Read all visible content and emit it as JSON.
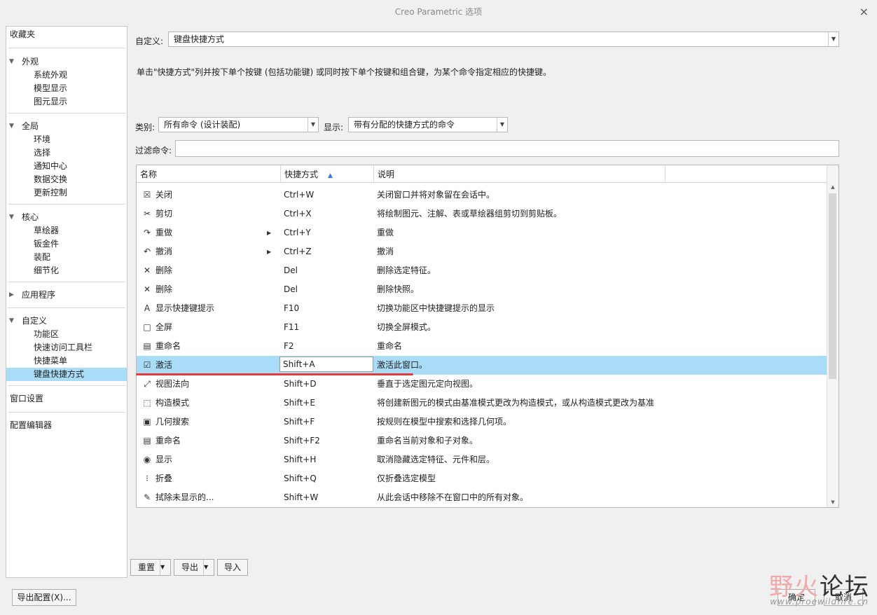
{
  "window": {
    "title": "Creo Parametric 选项",
    "close_glyph": "×"
  },
  "sidebar": {
    "favorites": "收藏夹",
    "groups": [
      {
        "title": "外观",
        "expanded": true,
        "items": [
          "系统外观",
          "模型显示",
          "图元显示"
        ]
      },
      {
        "title": "全局",
        "expanded": true,
        "items": [
          "环境",
          "选择",
          "通知中心",
          "数据交换",
          "更新控制"
        ]
      },
      {
        "title": "核心",
        "expanded": true,
        "items": [
          "草绘器",
          "钣金件",
          "装配",
          "细节化"
        ]
      },
      {
        "title": "应用程序",
        "expanded": false,
        "items": []
      },
      {
        "title": "自定义",
        "expanded": true,
        "items": [
          "功能区",
          "快速访问工具栏",
          "快捷菜单",
          "键盘快捷方式"
        ]
      }
    ],
    "selected_item": "键盘快捷方式",
    "window_settings": "窗口设置",
    "config_editor": "配置编辑器"
  },
  "customize": {
    "label": "自定义:",
    "value": "键盘快捷方式"
  },
  "instruction": "单击\"快捷方式\"列并按下单个按键 (包括功能键) 或同时按下单个按键和组合键，为某个命令指定相应的快捷键。",
  "category": {
    "label": "类别:",
    "value": "所有命令 (设计装配)"
  },
  "display": {
    "label": "显示:",
    "value": "带有分配的快捷方式的命令"
  },
  "filter": {
    "label": "过滤命令:",
    "value": ""
  },
  "table": {
    "columns": [
      "名称",
      "快捷方式",
      "说明"
    ],
    "sort_glyph": "▲",
    "rows": [
      {
        "icon": "close-window-icon",
        "glyph": "☒",
        "name": "关闭",
        "shortcut": "Ctrl+W",
        "desc": "关闭窗口并将对象留在会话中。"
      },
      {
        "icon": "scissors-icon",
        "glyph": "✂",
        "name": "剪切",
        "shortcut": "Ctrl+X",
        "desc": "将绘制图元、注解、表或草绘器组剪切到剪贴板。"
      },
      {
        "icon": "redo-icon",
        "glyph": "↷",
        "name": "重做",
        "shortcut": "Ctrl+Y",
        "desc": "重做",
        "submenu": true
      },
      {
        "icon": "undo-icon",
        "glyph": "↶",
        "name": "撤消",
        "shortcut": "Ctrl+Z",
        "desc": "撤消",
        "submenu": true
      },
      {
        "icon": "delete-icon",
        "glyph": "✕",
        "name": "删除",
        "shortcut": "Del",
        "desc": "删除选定特征。"
      },
      {
        "icon": "delete-icon",
        "glyph": "✕",
        "name": "删除",
        "shortcut": "Del",
        "desc": "删除快照。"
      },
      {
        "icon": "keytip-icon",
        "glyph": "A",
        "name": "显示快捷键提示",
        "shortcut": "F10",
        "desc": "切换功能区中快捷键提示的显示"
      },
      {
        "icon": "fullscreen-icon",
        "glyph": "□",
        "name": "全屏",
        "shortcut": "F11",
        "desc": "切换全屏模式。"
      },
      {
        "icon": "rename-icon",
        "glyph": "▤",
        "name": "重命名",
        "shortcut": "F2",
        "desc": "重命名"
      },
      {
        "icon": "activate-icon",
        "glyph": "☑",
        "name": "激活",
        "shortcut": "Shift+A",
        "desc": "激活此窗口。",
        "selected": true
      },
      {
        "icon": "view-normal-icon",
        "glyph": "⤢",
        "name": "视图法向",
        "shortcut": "Shift+D",
        "desc": "垂直于选定图元定向视图。"
      },
      {
        "icon": "construction-mode-icon",
        "glyph": "⬚",
        "name": "构造模式",
        "shortcut": "Shift+E",
        "desc": "将创建新图元的模式由基准模式更改为构造模式，或从构造模式更改为基准"
      },
      {
        "icon": "geometry-search-icon",
        "glyph": "▣",
        "name": "几何搜索",
        "shortcut": "Shift+F",
        "desc": "按规则在模型中搜索和选择几何项。"
      },
      {
        "icon": "rename-icon",
        "glyph": "▤",
        "name": "重命名",
        "shortcut": "Shift+F2",
        "desc": "重命名当前对象和子对象。"
      },
      {
        "icon": "eye-icon",
        "glyph": "◉",
        "name": "显示",
        "shortcut": "Shift+H",
        "desc": "取消隐藏选定特征、元件和层。"
      },
      {
        "icon": "collapse-icon",
        "glyph": "⁝",
        "name": "折叠",
        "shortcut": "Shift+Q",
        "desc": "仅折叠选定模型"
      },
      {
        "icon": "erase-icon",
        "glyph": "✎",
        "name": "拭除未显示的...",
        "shortcut": "Shift+W",
        "desc": "从此会话中移除不在窗口中的所有对象。"
      }
    ]
  },
  "buttons": {
    "reset": "重置",
    "export": "导出",
    "import": "导入",
    "export_config": "导出配置(X)...",
    "ok": "确定",
    "cancel": "取消"
  },
  "watermark": {
    "part1": "野火",
    "part2": "论坛",
    "url": "www.proewildfire.cn"
  },
  "colors": {
    "selection": "#a8dcf7",
    "annotation_underline": "#e23b3b"
  }
}
